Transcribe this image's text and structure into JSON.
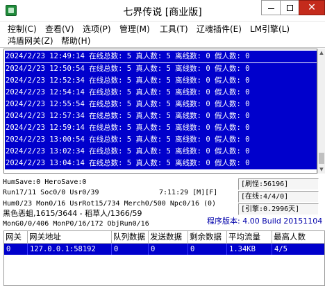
{
  "window": {
    "title": "七界传说 [商业版]",
    "minimize_label": "—",
    "close_label": "✕"
  },
  "menu": {
    "items": [
      "控制(C)",
      "查看(V)",
      "选项(P)",
      "管理(M)",
      "工具(T)",
      "辽魂插件(E)",
      "LM引擎(L)",
      "鸿盾网关(Z)",
      "帮助(H)"
    ]
  },
  "log": {
    "lines": [
      "2024/2/23 12:49:14 在线总数: 5 真人数: 5 离线数: 0 假人数: 0",
      "2024/2/23 12:50:54 在线总数: 5 真人数: 5 离线数: 0 假人数: 0",
      "2024/2/23 12:52:34 在线总数: 5 真人数: 5 离线数: 0 假人数: 0",
      "2024/2/23 12:54:14 在线总数: 5 真人数: 5 离线数: 0 假人数: 0",
      "2024/2/23 12:55:54 在线总数: 5 真人数: 5 离线数: 0 假人数: 0",
      "2024/2/23 12:57:34 在线总数: 5 真人数: 5 离线数: 0 假人数: 0",
      "2024/2/23 12:59:14 在线总数: 5 真人数: 5 离线数: 0 假人数: 0",
      "2024/2/23 13:00:54 在线总数: 5 真人数: 5 离线数: 0 假人数: 0",
      "2024/2/23 13:02:34 在线总数: 5 真人数: 5 离线数: 0 假人数: 0",
      "2024/2/23 13:04:14 在线总数: 5 真人数: 5 离线数: 0 假人数: 0"
    ]
  },
  "status": {
    "humsave": "HumSave:0 HeroSave:0",
    "run": "Run17/11 Soc0/0 Usr0/39",
    "time": "7:11:29 [M][F]",
    "hum": "Hum0/23 Mon0/16 UsrRot15/734 Merch0/500 Npc0/16 (0)",
    "monster": "黑色恶蛆,1615/3644 - 稻草人/1366/59",
    "mong": "MonG0/0/406 MonP0/16/172 ObjRun0/16"
  },
  "panels": {
    "refresh": "[刷怪:56196]",
    "online": "[在线:4/4/0]",
    "engine": "[引擎:0.2996天]"
  },
  "version": "程序版本: 4.00 Build 20151104",
  "gateway_table": {
    "headers": [
      "网关",
      "网关地址",
      "队列数据",
      "发送数据",
      "剩余数据",
      "平均流量",
      "最高人数"
    ],
    "rows": [
      [
        "0",
        "127.0.0.1:58192",
        "0",
        "0",
        "0",
        "1.34KB",
        "4/5"
      ]
    ]
  }
}
